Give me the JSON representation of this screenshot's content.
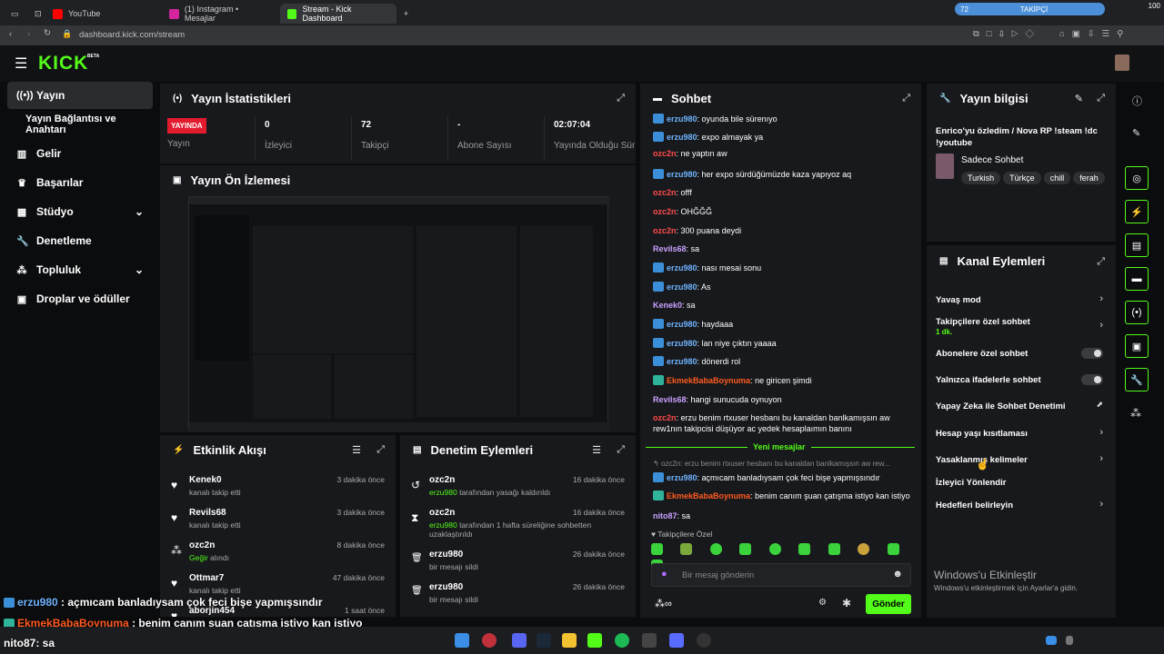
{
  "browser": {
    "tabs": [
      "YouTube",
      "(1) Instagram • Mesajlar",
      "Stream - Kick Dashboard"
    ],
    "url": "dashboard.kick.com/stream"
  },
  "widget": {
    "count": "72",
    "label": "TAKİPÇİ",
    "score": "100"
  },
  "app": {
    "logo": "KICK",
    "logo_sup": "BETA"
  },
  "nav": {
    "items": [
      "Yayın",
      "Yayın Bağlantısı ve Anahtarı",
      "Gelir",
      "Başarılar",
      "Stüdyo",
      "Denetleme",
      "Topluluk",
      "Droplar ve ödüller"
    ]
  },
  "stats": {
    "title": "Yayın İstatistikleri",
    "live": "YAYINDA",
    "cells": [
      {
        "value": "",
        "label": "Yayın"
      },
      {
        "value": "0",
        "label": "İzleyici"
      },
      {
        "value": "72",
        "label": "Takipçi"
      },
      {
        "value": "-",
        "label": "Abone Sayısı"
      },
      {
        "value": "02:07:04",
        "label": "Yayında Olduğu Süre"
      }
    ]
  },
  "preview": {
    "title": "Yayın Ön İzlemesi"
  },
  "activity": {
    "title": "Etkinlik Akışı",
    "items": [
      {
        "name": "Kenek0",
        "sub": "kanalı takip etti",
        "time": "3 dakika önce",
        "icon": "♥"
      },
      {
        "name": "Revils68",
        "sub": "kanalı takip etti",
        "time": "3 dakika önce",
        "icon": "♥"
      },
      {
        "name": "ozc2n",
        "sub_highlight": "Geğir",
        "sub": "alındı",
        "time": "8 dakika önce",
        "icon": "⁂"
      },
      {
        "name": "Ottmar7",
        "sub": "kanalı takip etti",
        "time": "47 dakika önce",
        "icon": "♥"
      },
      {
        "name": "aborjin454",
        "sub": "",
        "time": "1 saat önce",
        "icon": "♥"
      }
    ]
  },
  "moderation": {
    "title": "Denetim Eylemleri",
    "items": [
      {
        "name": "ozc2n",
        "actor": "erzu980",
        "sub": "tarafından yasağı kaldırıldı",
        "time": "16 dakika önce",
        "icon": "↺"
      },
      {
        "name": "ozc2n",
        "actor": "erzu980",
        "sub": "tarafından 1 hafta süreliğine sohbetten uzaklaştırıldı",
        "time": "16 dakika önce",
        "icon": "⧗"
      },
      {
        "name": "erzu980",
        "actor": "",
        "sub": "bir mesajı sildi",
        "time": "26 dakika önce",
        "icon": "🗑"
      },
      {
        "name": "erzu980",
        "actor": "",
        "sub": "bir mesajı sildi",
        "time": "26 dakika önce",
        "icon": "🗑"
      }
    ]
  },
  "chat": {
    "title": "Sohbet",
    "messages": [
      {
        "user": "erzu980",
        "color": "blue",
        "badge": true,
        "text": "oyunda bile sürenıyo"
      },
      {
        "user": "erzu980",
        "color": "blue",
        "badge": true,
        "text": "expo almayak ya"
      },
      {
        "user": "ozc2n",
        "color": "red",
        "badge": false,
        "text": "ne yaptın aw"
      },
      {
        "user": "erzu980",
        "color": "blue",
        "badge": true,
        "text": "her expo sürdüğümüzde kaza yapıyoz aq"
      },
      {
        "user": "ozc2n",
        "color": "red",
        "badge": false,
        "text": "offf"
      },
      {
        "user": "ozc2n",
        "color": "red",
        "badge": false,
        "text": "OHĞĞĞ"
      },
      {
        "user": "ozc2n",
        "color": "red",
        "badge": false,
        "text": "300 puana deydi"
      },
      {
        "user": "Revils68",
        "color": "purple",
        "badge": false,
        "text": "sa"
      },
      {
        "user": "erzu980",
        "color": "blue",
        "badge": true,
        "text": "nası mesai sonu"
      },
      {
        "user": "erzu980",
        "color": "blue",
        "badge": true,
        "text": "As"
      },
      {
        "user": "Kenek0",
        "color": "purple",
        "badge": false,
        "text": "sa"
      },
      {
        "user": "erzu980",
        "color": "blue",
        "badge": true,
        "text": "haydaaa"
      },
      {
        "user": "erzu980",
        "color": "blue",
        "badge": true,
        "text": "lan niye çıktın yaaaa"
      },
      {
        "user": "erzu980",
        "color": "blue",
        "badge": true,
        "text": "dönerdi rol"
      },
      {
        "user": "EkmekBabaBoynuma",
        "color": "orange",
        "badge": "teal",
        "text": "ne giricen şimdi"
      },
      {
        "user": "Revils68",
        "color": "purple",
        "badge": false,
        "text": "hangi sunucuda oynuyon"
      },
      {
        "user": "ozc2n",
        "color": "red",
        "badge": false,
        "text": "erzu benim rtxuser hesbanı bu kanaldan banlkamışsın aw rew1nın takipcisi düşüyor ac yedek hesaplaımın banını"
      }
    ],
    "divider": "Yeni mesajlar",
    "reply_preview": "ozc2n: erzu benim rtxuser hesbanı bu kanaldan banlkamışsın aw rew...",
    "after": [
      {
        "user": "erzu980",
        "color": "blue",
        "badge": true,
        "text": "açmıcam banladıysam çok feci bişe yapmışsındır"
      },
      {
        "user": "EkmekBabaBoynuma",
        "color": "orange",
        "badge": "teal",
        "text": "benim canım şuan çatışma istiyo kan istiyo"
      },
      {
        "user": "nito87",
        "color": "purple",
        "badge": false,
        "text": "sa"
      }
    ],
    "mode": "Takipçilere Özel",
    "placeholder": "Bir mesaj gönderin",
    "send": "Gönder"
  },
  "stream_info": {
    "title": "Yayın bilgisi",
    "stream_title": "Enrico'yu özledim / Nova RP !steam !dc !youtube",
    "category": "Sadece Sohbet",
    "tags": [
      "Turkish",
      "Türkçe",
      "chill",
      "ferah"
    ]
  },
  "channel_actions": {
    "title": "Kanal Eylemleri",
    "items": [
      {
        "label": "Yavaş mod",
        "type": "arrow"
      },
      {
        "label": "Takipçilere özel sohbet",
        "sub": "1 dk.",
        "type": "arrow"
      },
      {
        "label": "Abonelere özel sohbet",
        "type": "toggle"
      },
      {
        "label": "Yalnızca ifadelerle sohbet",
        "type": "toggle"
      },
      {
        "label": "Yapay Zeka ile Sohbet Denetimi",
        "type": "link"
      },
      {
        "label": "Hesap yaşı kısıtlaması",
        "type": "arrow"
      },
      {
        "label": "Yasaklanmış kelimeler",
        "type": "arrow"
      },
      {
        "label": "İzleyici Yönlendir",
        "type": "none"
      },
      {
        "label": "Hedefleri belirleyin",
        "type": "arrow"
      }
    ]
  },
  "windows": {
    "activate_title": "Windows'u Etkinleştir",
    "activate_sub": "Windows'u etkinleştirmek için Ayarlar'a gidin."
  },
  "overlay": [
    {
      "user": "erzu980",
      "text": ": açmıcam banladıysam çok feci bişe yapmışsındır",
      "color": "blue"
    },
    {
      "user": "EkmekBabaBoynuma",
      "text": ": benim canım şuan çatışma istiyo kan istiyo",
      "color": "orange"
    },
    {
      "user": "nito87",
      "text": ": sa",
      "color": "white"
    }
  ]
}
